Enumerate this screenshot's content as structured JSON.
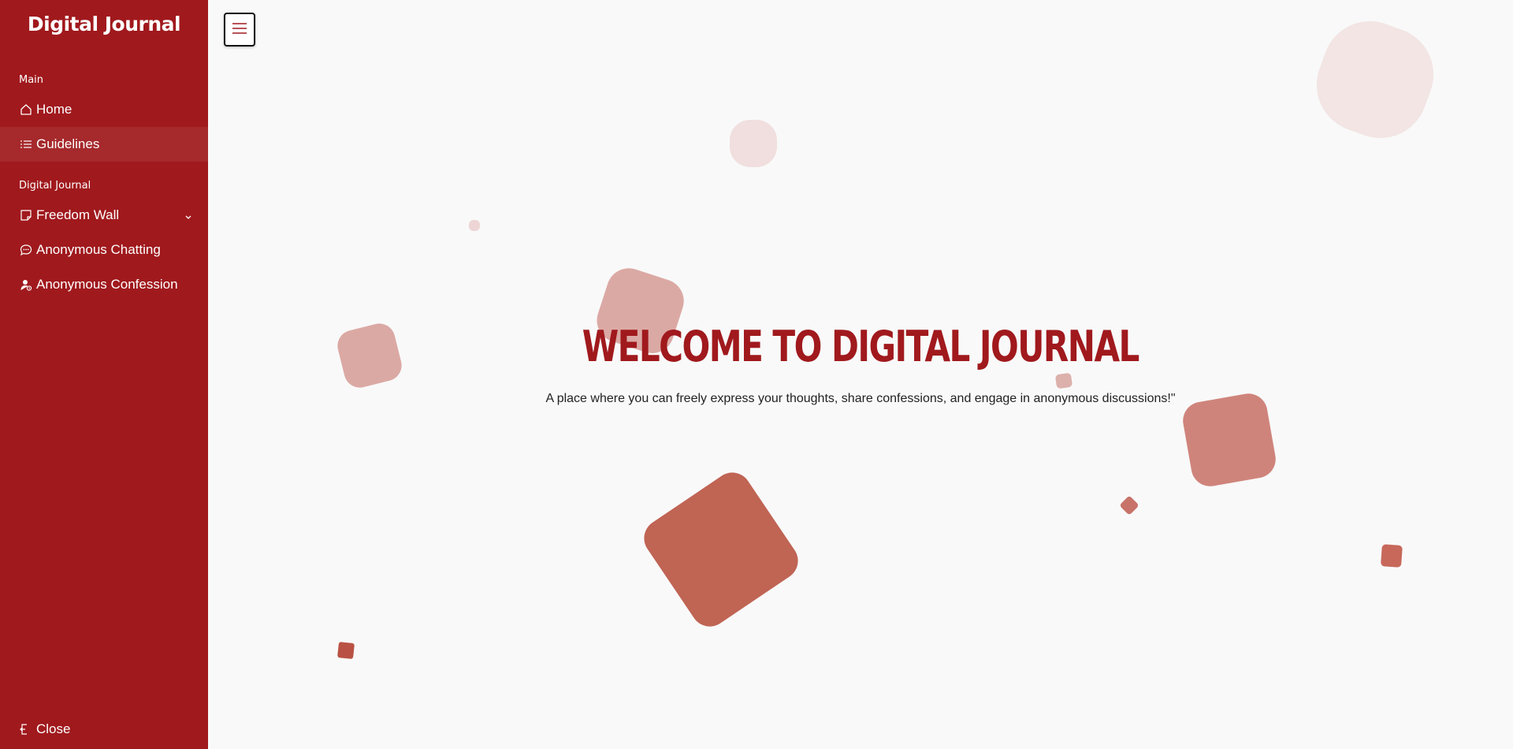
{
  "sidebar": {
    "brand": "Digital Journal",
    "sections": [
      {
        "label": "Main",
        "items": [
          {
            "label": "Home",
            "icon": "home-icon"
          },
          {
            "label": "Guidelines",
            "icon": "list-icon"
          }
        ]
      },
      {
        "label": "Digital Journal",
        "items": [
          {
            "label": "Freedom Wall",
            "icon": "note-icon"
          },
          {
            "label": "Anonymous Chatting",
            "icon": "chat-icon"
          },
          {
            "label": "Anonymous Confession",
            "icon": "user-icon"
          }
        ]
      }
    ],
    "close_label": "Close"
  },
  "hero": {
    "title": "Welcome to Digital Journal",
    "subtitle": "A place where you can freely express your thoughts, share confessions, and engage in anonymous discussions!\""
  },
  "colors": {
    "brand": "#a0191d",
    "background": "#f9f9f9"
  }
}
